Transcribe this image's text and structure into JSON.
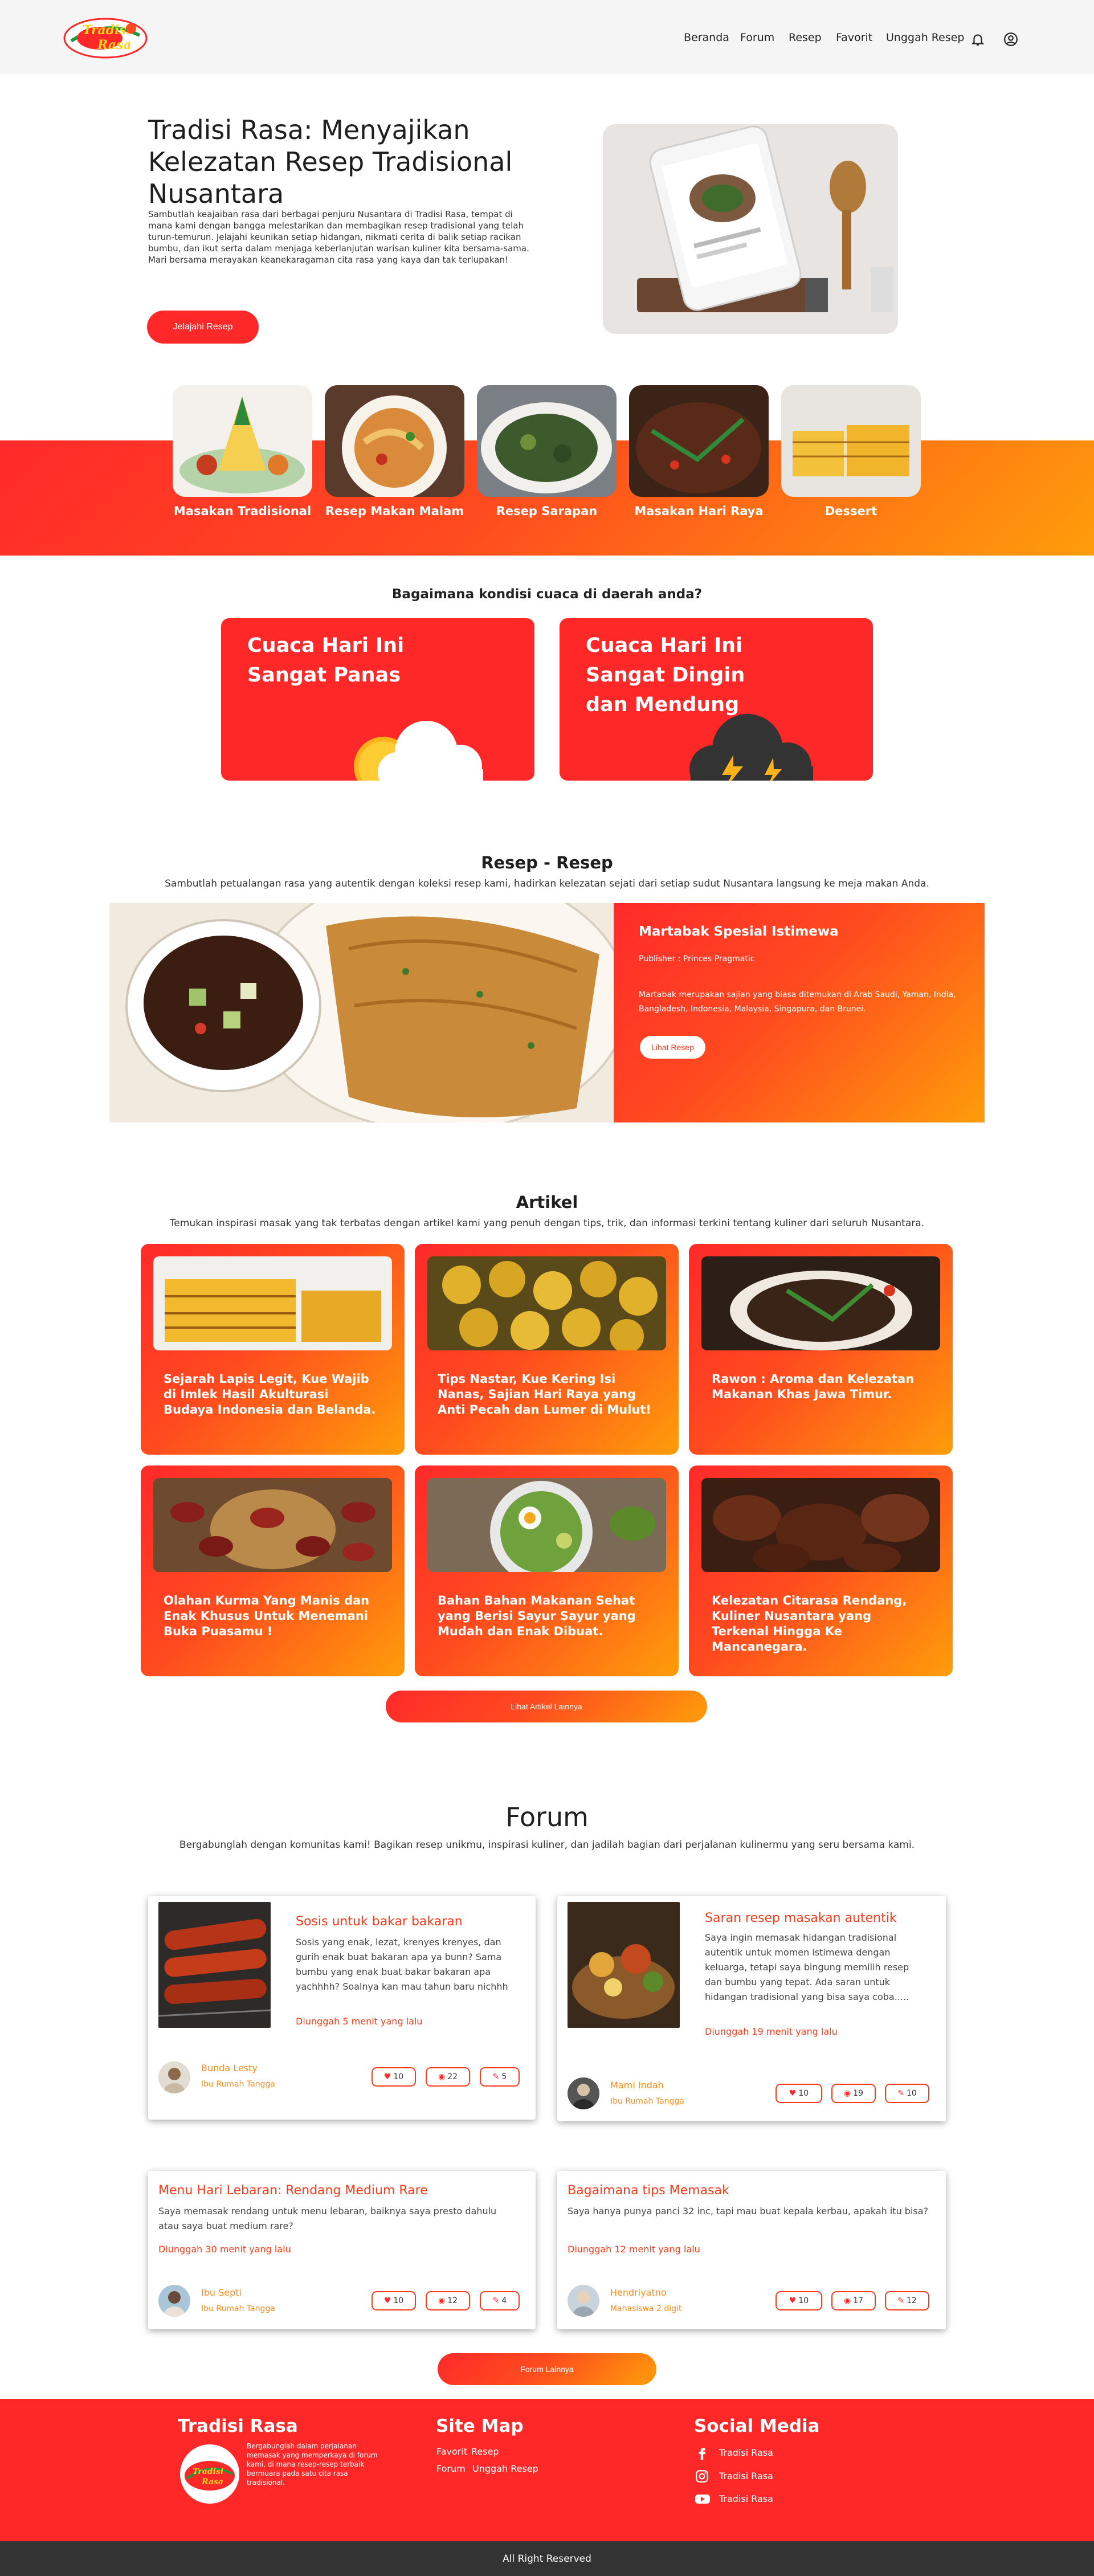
{
  "nav": {
    "items": [
      "Beranda",
      "Forum",
      "Resep",
      "Favorit",
      "Unggah Resep"
    ],
    "logo_text": "Tradisi Rasa"
  },
  "hero": {
    "title": "Tradisi Rasa: Menyajikan Kelezatan Resep Tradisional Nusantara",
    "desc": "Sambutlah keajaiban rasa dari berbagai penjuru Nusantara di Tradisi Rasa, tempat di mana kami dengan bangga melestarikan dan membagikan resep tradisional yang telah turun-temurun. Jelajahi keunikan setiap hidangan, nikmati cerita di balik setiap racikan bumbu, dan ikut serta dalam menjaga keberlanjutan warisan kuliner kita bersama-sama. Mari bersama merayakan keanekaragaman cita rasa yang kaya dan tak terlupakan!",
    "button": "Jelajahi Resep"
  },
  "categories": [
    "Masakan Tradisional",
    "Resep Makan Malam",
    "Resep Sarapan",
    "Masakan Hari Raya",
    "Dessert"
  ],
  "weather": {
    "question": "Bagaimana kondisi cuaca di daerah anda?",
    "hot": "Cuaca Hari Ini Sangat Panas",
    "cold": "Cuaca Hari Ini Sangat Dingin dan Mendung"
  },
  "recipes": {
    "title": "Resep - Resep",
    "subtitle": "Sambutlah petualangan rasa yang autentik dengan koleksi resep kami, hadirkan kelezatan sejati dari setiap sudut Nusantara langsung ke meja makan Anda.",
    "featured": {
      "name": "Martabak Spesial Istimewa",
      "publisher": "Publisher : Princes Pragmatic",
      "desc": "Martabak merupakan sajian yang biasa ditemukan di Arab Saudi, Yaman, India, Bangladesh, Indonesia, Malaysia, Singapura, dan Brunei.",
      "button": "Lihat Resep"
    }
  },
  "articles": {
    "title": "Artikel",
    "subtitle": "Temukan inspirasi masak yang tak terbatas dengan artikel kami yang penuh dengan tips, trik, dan informasi terkini tentang kuliner dari seluruh Nusantara.",
    "items": [
      "Sejarah Lapis Legit, Kue Wajib di Imlek Hasil Akulturasi Budaya Indonesia dan Belanda.",
      "Tips Nastar, Kue Kering Isi Nanas, Sajian Hari Raya yang Anti Pecah dan Lumer di Mulut!",
      "Rawon : Aroma dan Kelezatan Makanan Khas Jawa Timur.",
      "Olahan Kurma Yang Manis dan Enak Khusus Untuk Menemani Buka Puasamu !",
      "Bahan Bahan Makanan Sehat yang Berisi Sayur Sayur yang Mudah dan Enak Dibuat.",
      "Kelezatan Citarasa Rendang, Kuliner Nusantara yang Terkenal Hingga Ke Mancanegara."
    ],
    "button": "Lihat Artikel Lainnya"
  },
  "forum": {
    "title": "Forum",
    "subtitle": "Bergabunglah dengan komunitas kami! Bagikan resep unikmu, inspirasi kuliner, dan jadilah bagian dari perjalanan kulinermu yang seru bersama kami.",
    "posts": [
      {
        "title": "Sosis untuk bakar bakaran",
        "body": "Sosis yang enak, lezat, krenyes krenyes, dan gurih enak buat bakaran apa ya bunn? Sama bumbu yang enak buat bakar bakaran apa yachhhh? Soalnya kan mau tahun baru nichhh",
        "time": "Diunggah 5 menit yang lalu",
        "user": "Bunda Lesty",
        "role": "Ibu Rumah Tangga",
        "likes": "10",
        "views": "22",
        "comments": "5"
      },
      {
        "title": "Saran resep masakan autentik",
        "body": "Saya ingin memasak hidangan tradisional autentik untuk momen istimewa dengan keluarga, tetapi saya bingung memilih resep dan bumbu yang tepat. Ada saran untuk hidangan tradisional yang bisa saya coba.....",
        "time": "Diunggah 19 menit yang lalu",
        "user": "Mami Indah",
        "role": "Ibu Rumah Tangga",
        "likes": "10",
        "views": "19",
        "comments": "10"
      },
      {
        "title": "Menu Hari Lebaran: Rendang Medium Rare",
        "body": "Saya memasak rendang untuk menu lebaran, baiknya saya presto dahulu atau saya buat medium rare?",
        "time": "Diunggah 30 menit yang lalu",
        "user": "Ibu Septi",
        "role": "Ibu Rumah Tangga",
        "likes": "10",
        "views": "12",
        "comments": "4"
      },
      {
        "title": "Bagaimana tips Memasak",
        "body": "Saya hanya punya panci 32 inc, tapi mau buat kepala kerbau, apakah itu bisa?",
        "time": "Diunggah 12 menit yang lalu",
        "user": "Hendriyatno",
        "role": "Mahasiswa 2 digit",
        "likes": "10",
        "views": "17",
        "comments": "12"
      }
    ],
    "button": "Forum Lainnya"
  },
  "footer": {
    "brand": "Tradisi Rasa",
    "about": "Bergabunglah dalam perjalanan memasak yang memperkaya di forum kami, di mana resep-resep terbaik bermuara pada satu cita rasa tradisional.",
    "sitemap_title": "Site Map",
    "sitemap": [
      "Favorit",
      "Resep",
      "Forum",
      "Unggah Resep"
    ],
    "social_title": "Social Media",
    "social": [
      "Tradisi Rasa",
      "Tradisi Rasa",
      "Tradisi Rasa"
    ],
    "copyright": "All Right Reserved"
  },
  "colors": {
    "primary": "#ff2828",
    "accent": "#ff9d0a",
    "footer_bottom": "#333333"
  }
}
